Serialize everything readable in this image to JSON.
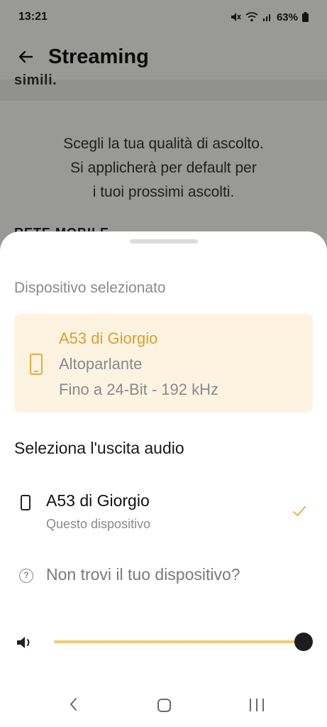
{
  "status_bar": {
    "time": "13:21",
    "battery": "63%",
    "icons": [
      "mute-icon",
      "wifi-icon",
      "signal-icon",
      "battery-icon"
    ]
  },
  "header": {
    "title": "Streaming",
    "back_icon": "arrow-left-icon"
  },
  "background": {
    "cut_text": "simili.",
    "intro_lines": [
      "Scegli la tua qualità di ascolto.",
      "Si applicherà per default per",
      "i tuoi prossimi ascolti."
    ],
    "section_cut": "RETE MOBILE"
  },
  "sheet": {
    "selected_label": "Dispositivo selezionato",
    "selected_card": {
      "name": "A53 di Giorgio",
      "type": "Altoparlante",
      "quality": "Fino a 24-Bit - 192 kHz",
      "icon": "phone-icon"
    },
    "output_heading": "Seleziona l'uscita audio",
    "devices": [
      {
        "name": "A53 di Giorgio",
        "subtitle": "Questo dispositivo",
        "selected": true,
        "icon": "phone-icon"
      }
    ],
    "help_text": "Non trovi il tuo dispositivo?",
    "volume": {
      "level": 1.0,
      "icon": "speaker-icon"
    }
  },
  "colors": {
    "accent": "#e3ad39",
    "card_bg": "#fdf3e1",
    "slider_fill": "#f4cc6b",
    "thumb": "#1e1e1e"
  },
  "nav_bar": {
    "icons": [
      "nav-back-icon",
      "nav-home-icon",
      "nav-recents-icon"
    ]
  }
}
